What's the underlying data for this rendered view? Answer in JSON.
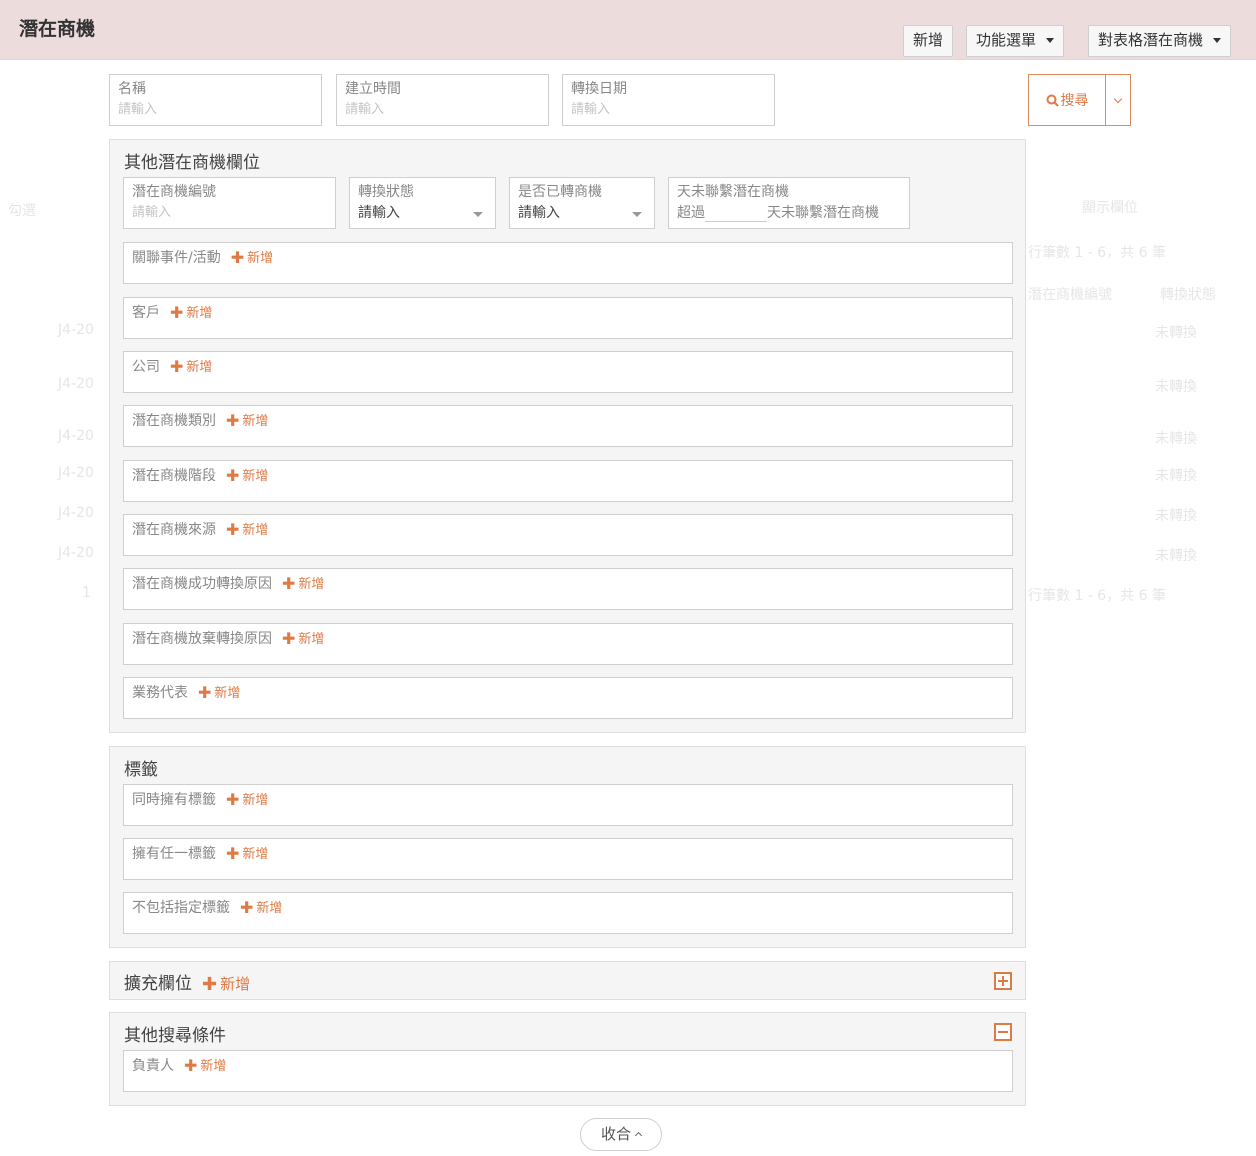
{
  "header": {
    "title": "潛在商機",
    "add_label": "新增",
    "function_menu_label": "功能選單",
    "table_menu_label": "對表格潛在商機"
  },
  "search": {
    "name": {
      "label": "名稱",
      "placeholder": "請輸入"
    },
    "created": {
      "label": "建立時間",
      "placeholder": "請輸入"
    },
    "converted_date": {
      "label": "轉換日期",
      "placeholder": "請輸入"
    },
    "search_label": "搜尋"
  },
  "other_fields": {
    "title": "其他潛在商機欄位",
    "number": {
      "label": "潛在商機編號",
      "placeholder": "請輸入"
    },
    "status": {
      "label": "轉換狀態",
      "value": "請輸入"
    },
    "converted": {
      "label": "是否已轉商機",
      "value": "請輸入"
    },
    "uncontacted": {
      "label": "天未聯繫潛在商機",
      "prefix": "超過",
      "suffix": "天未聯繫潛在商機"
    },
    "rows": [
      {
        "label": "關聯事件/活動"
      },
      {
        "label": "客戶"
      },
      {
        "label": "公司"
      },
      {
        "label": "潛在商機類別"
      },
      {
        "label": "潛在商機階段"
      },
      {
        "label": "潛在商機來源"
      },
      {
        "label": "潛在商機成功轉換原因"
      },
      {
        "label": "潛在商機放棄轉換原因"
      },
      {
        "label": "業務代表"
      }
    ]
  },
  "tags": {
    "title": "標籤",
    "rows": [
      {
        "label": "同時擁有標籤"
      },
      {
        "label": "擁有任一標籤"
      },
      {
        "label": "不包括指定標籤"
      }
    ]
  },
  "extended": {
    "title": "擴充欄位"
  },
  "other_search": {
    "title": "其他搜尋條件",
    "rows": [
      {
        "label": "負責人"
      }
    ]
  },
  "add_label": "新增",
  "collapse_label": "收合",
  "background": {
    "select_label": "勾選",
    "page_info": "行筆數 1 - 6，共 6 筆",
    "col_number": "潛在商機編號",
    "col_status": "轉換狀態",
    "col_display": "顯示欄位",
    "row_id": "J4-20",
    "row_value": "未轉換",
    "page_number": "1"
  },
  "colors": {
    "accent": "#e07a45",
    "header_bg": "#ecdcdc"
  }
}
